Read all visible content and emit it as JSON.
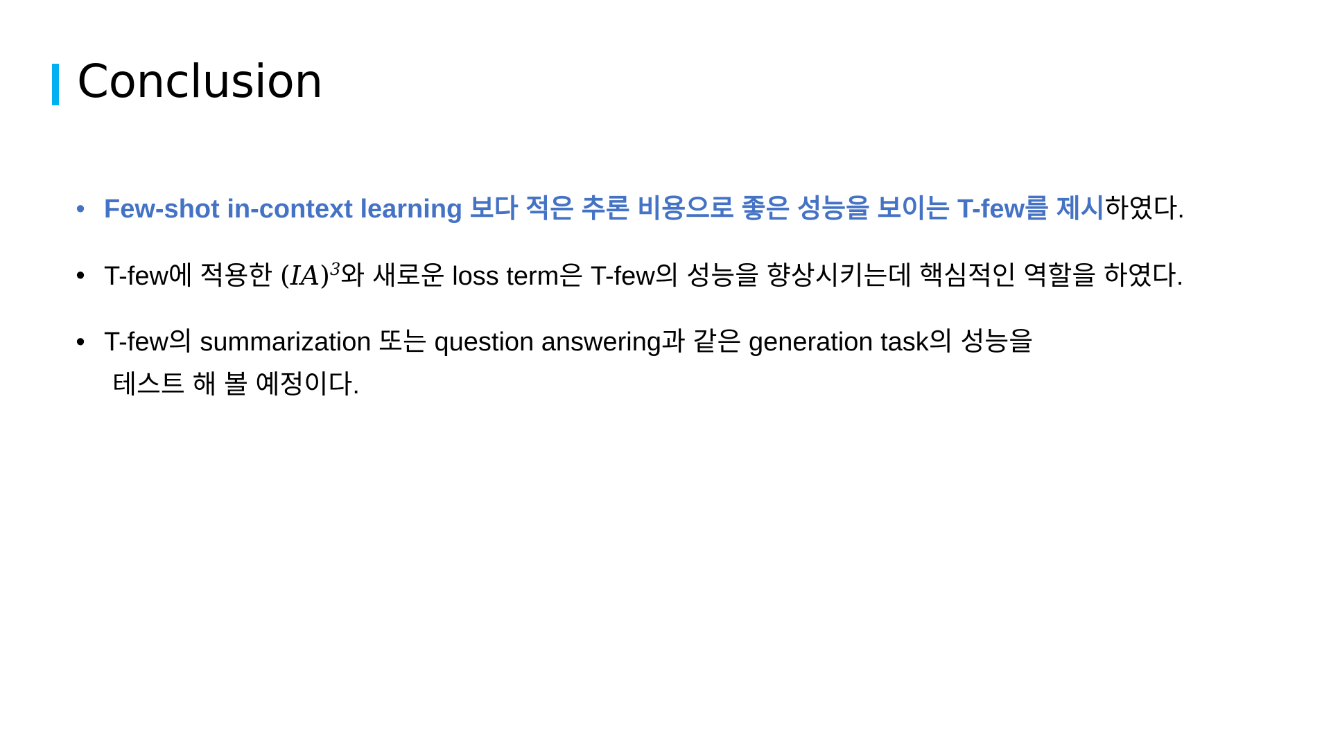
{
  "slide": {
    "title": "Conclusion",
    "accent_color": "#00B0F0",
    "highlight_color": "#4472C4",
    "bullet_glyph": "•",
    "bullets": [
      {
        "highlight_text": "Few-shot in-context learning 보다 적은 추론 비용으로 좋은 성능을 보이는 T-few를 제시",
        "rest_text": "하였다."
      },
      {
        "prefix": "T-few에 적용한 ",
        "math_open": "(",
        "math_body": "IA",
        "math_close": ")",
        "math_sup": "3",
        "suffix": "와 새로운 loss term은 T-few의 성능을 향상시키는데 핵심적인 역할을 하였다."
      },
      {
        "line1": "T-few의 summarization 또는 question answering과 같은 generation task의 성능을",
        "line2": "테스트 해 볼 예정이다."
      }
    ]
  }
}
